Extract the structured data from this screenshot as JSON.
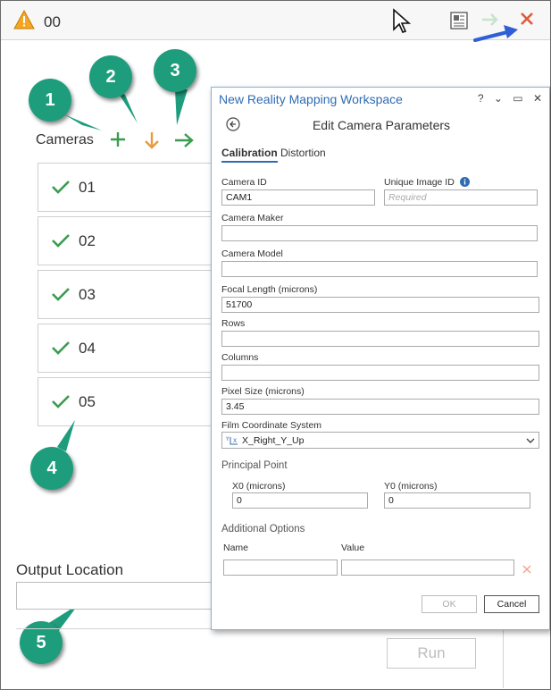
{
  "topbar": {
    "title": "00"
  },
  "cameras": {
    "label": "Cameras",
    "items": [
      {
        "label": "01"
      },
      {
        "label": "02"
      },
      {
        "label": "03"
      },
      {
        "label": "04"
      },
      {
        "label": "05"
      }
    ]
  },
  "callouts": [
    "1",
    "2",
    "3",
    "4",
    "5"
  ],
  "output": {
    "label": "Output Location",
    "value": ""
  },
  "run_label": "Run",
  "dialog": {
    "title": "New Reality Mapping Workspace",
    "controls": "? ⌄ ▭ ✕",
    "heading": "Edit Camera Parameters",
    "tabs": {
      "calibration": "Calibration",
      "distortion": "Distortion"
    },
    "fields": {
      "camera_id": {
        "label": "Camera ID",
        "value": "CAM1"
      },
      "unique_image_id": {
        "label": "Unique Image ID",
        "placeholder": "Required"
      },
      "camera_maker": {
        "label": "Camera Maker",
        "value": ""
      },
      "camera_model": {
        "label": "Camera Model",
        "value": ""
      },
      "focal_length": {
        "label": "Focal Length (microns)",
        "value": "51700"
      },
      "rows": {
        "label": "Rows",
        "value": ""
      },
      "columns": {
        "label": "Columns",
        "value": ""
      },
      "pixel_size": {
        "label": "Pixel Size (microns)",
        "value": "3.45"
      },
      "film_coord": {
        "label": "Film Coordinate System",
        "value": "X_Right_Y_Up"
      }
    },
    "principal_point": {
      "label": "Principal Point",
      "x0": {
        "label": "X0 (microns)",
        "value": "0"
      },
      "y0": {
        "label": "Y0 (microns)",
        "value": "0"
      }
    },
    "additional": {
      "label": "Additional Options",
      "name_label": "Name",
      "value_label": "Value"
    },
    "ok_label": "OK",
    "cancel_label": "Cancel"
  },
  "colors": {
    "accent": "#2e6cb3",
    "callout": "#1e9d7d",
    "check": "#3a9c4e",
    "close": "#e05a3a",
    "down_arrow": "#e89b3c"
  }
}
